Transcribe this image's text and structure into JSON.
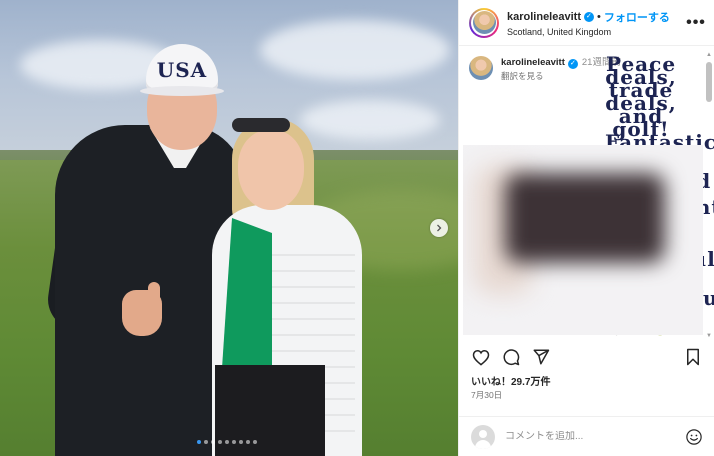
{
  "header": {
    "username": "karolineleavitt",
    "separator": "•",
    "follow_label": "フォローする",
    "location": "Scotland, United Kingdom",
    "more_label": "•••"
  },
  "caption": {
    "username": "karolineleavitt",
    "time": "21週間前",
    "text": "Peace deals, trade deals, and golf! Fantastic trip to Scotland with President Trump. What a beautiful country with wonderful people. 🏴 ⛳",
    "translate_label": "翻訳を見る"
  },
  "media": {
    "cap_text": "USA",
    "carousel_total": 9,
    "carousel_active": 0
  },
  "stats": {
    "likes": "いいね！29.7万件",
    "date": "7月30日"
  },
  "comment": {
    "placeholder": "コメントを追加..."
  },
  "icons": {
    "verified": "verified-badge-icon",
    "like": "heart-icon",
    "comment": "comment-icon",
    "share": "share-icon",
    "save": "bookmark-icon",
    "emoji": "emoji-icon",
    "next": "chevron-right-icon"
  },
  "colors": {
    "accent": "#0095f6",
    "text": "#262626",
    "muted": "#737373"
  }
}
